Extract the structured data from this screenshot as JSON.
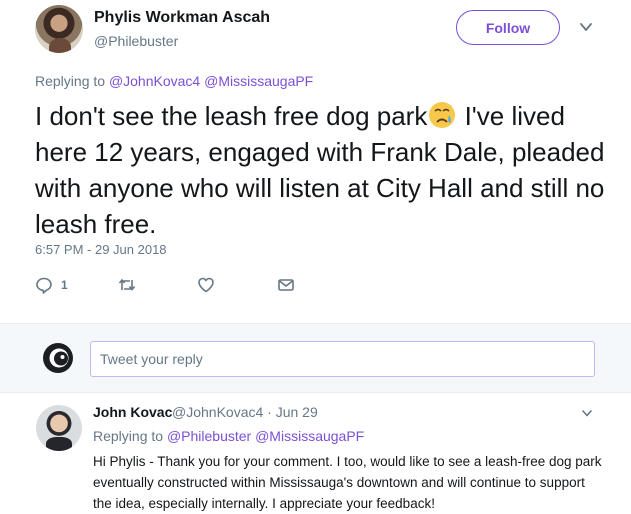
{
  "tweet": {
    "author_name": "Phylis Workman Ascah",
    "author_handle": "@Philebuster",
    "follow_label": "Follow",
    "replying_prefix": "Replying to",
    "replying_mentions": [
      "@JohnKovac4",
      "@MississaugaPF"
    ],
    "text_before_emoji": "I don't see the leash free dog park",
    "text_after_emoji": " I've lived here 12 years, engaged with Frank Dale, pleaded with anyone who will listen at City Hall and still no leash free.",
    "emoji": "crying-face-emoji",
    "timestamp": "6:57 PM - 29 Jun 2018",
    "reply_count": "1"
  },
  "compose": {
    "placeholder": "Tweet your reply"
  },
  "reply": {
    "author_name": "John Kovac",
    "meta": "@JohnKovac4 · Jun 29",
    "replying_prefix": "Replying to",
    "replying_mentions": [
      "@Philebuster",
      "@MississaugaPF"
    ],
    "text": "Hi Phylis - Thank you for your comment. I too, would like to see a leash-free dog park eventually constructed within Mississauga's downtown and will continue to support the idea, especially internally. I appreciate your feedback!"
  },
  "colors": {
    "accent": "#7b4fd6",
    "muted": "#657786",
    "text": "#14171a"
  }
}
